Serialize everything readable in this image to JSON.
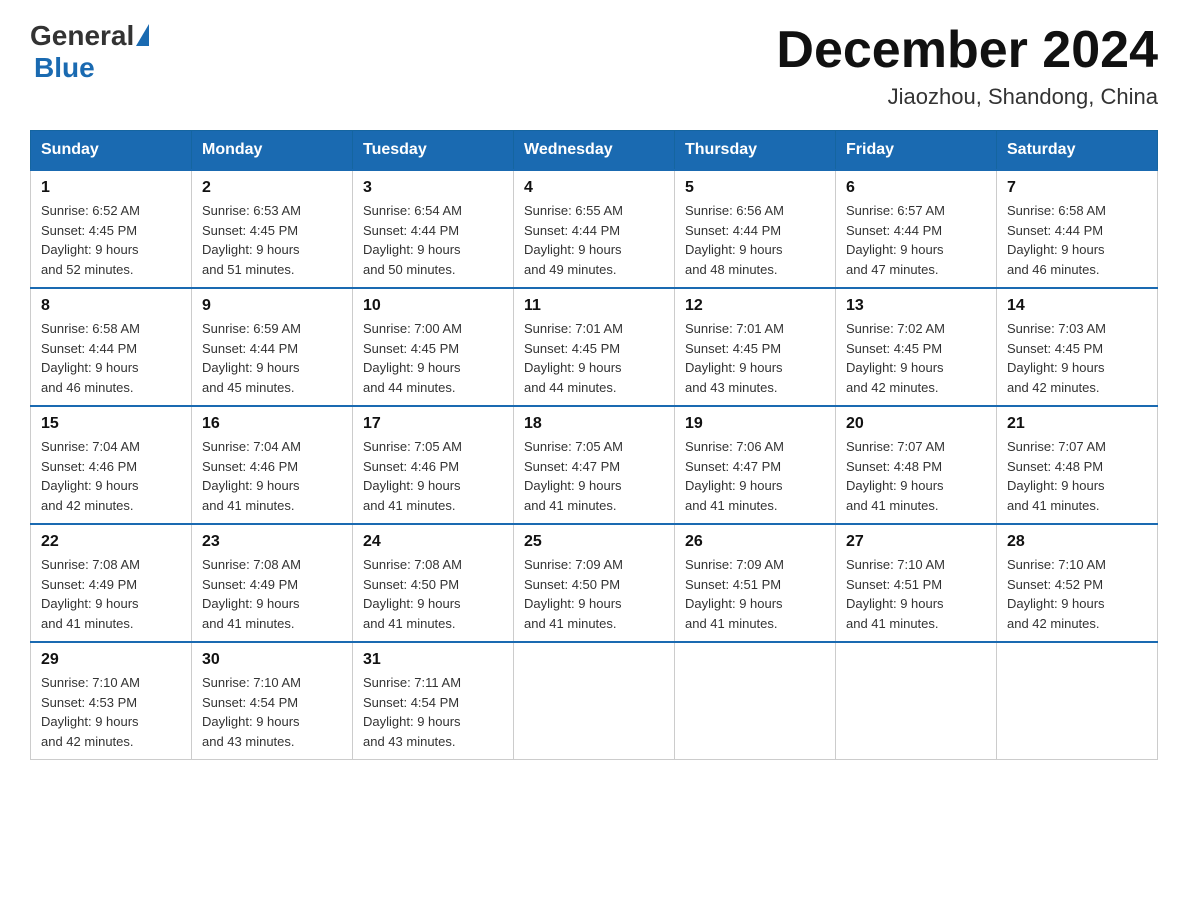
{
  "header": {
    "logo_general": "General",
    "logo_blue": "Blue",
    "title": "December 2024",
    "subtitle": "Jiaozhou, Shandong, China"
  },
  "columns": [
    "Sunday",
    "Monday",
    "Tuesday",
    "Wednesday",
    "Thursday",
    "Friday",
    "Saturday"
  ],
  "weeks": [
    [
      {
        "day": "1",
        "sunrise": "6:52 AM",
        "sunset": "4:45 PM",
        "daylight": "9 hours and 52 minutes."
      },
      {
        "day": "2",
        "sunrise": "6:53 AM",
        "sunset": "4:45 PM",
        "daylight": "9 hours and 51 minutes."
      },
      {
        "day": "3",
        "sunrise": "6:54 AM",
        "sunset": "4:44 PM",
        "daylight": "9 hours and 50 minutes."
      },
      {
        "day": "4",
        "sunrise": "6:55 AM",
        "sunset": "4:44 PM",
        "daylight": "9 hours and 49 minutes."
      },
      {
        "day": "5",
        "sunrise": "6:56 AM",
        "sunset": "4:44 PM",
        "daylight": "9 hours and 48 minutes."
      },
      {
        "day": "6",
        "sunrise": "6:57 AM",
        "sunset": "4:44 PM",
        "daylight": "9 hours and 47 minutes."
      },
      {
        "day": "7",
        "sunrise": "6:58 AM",
        "sunset": "4:44 PM",
        "daylight": "9 hours and 46 minutes."
      }
    ],
    [
      {
        "day": "8",
        "sunrise": "6:58 AM",
        "sunset": "4:44 PM",
        "daylight": "9 hours and 46 minutes."
      },
      {
        "day": "9",
        "sunrise": "6:59 AM",
        "sunset": "4:44 PM",
        "daylight": "9 hours and 45 minutes."
      },
      {
        "day": "10",
        "sunrise": "7:00 AM",
        "sunset": "4:45 PM",
        "daylight": "9 hours and 44 minutes."
      },
      {
        "day": "11",
        "sunrise": "7:01 AM",
        "sunset": "4:45 PM",
        "daylight": "9 hours and 44 minutes."
      },
      {
        "day": "12",
        "sunrise": "7:01 AM",
        "sunset": "4:45 PM",
        "daylight": "9 hours and 43 minutes."
      },
      {
        "day": "13",
        "sunrise": "7:02 AM",
        "sunset": "4:45 PM",
        "daylight": "9 hours and 42 minutes."
      },
      {
        "day": "14",
        "sunrise": "7:03 AM",
        "sunset": "4:45 PM",
        "daylight": "9 hours and 42 minutes."
      }
    ],
    [
      {
        "day": "15",
        "sunrise": "7:04 AM",
        "sunset": "4:46 PM",
        "daylight": "9 hours and 42 minutes."
      },
      {
        "day": "16",
        "sunrise": "7:04 AM",
        "sunset": "4:46 PM",
        "daylight": "9 hours and 41 minutes."
      },
      {
        "day": "17",
        "sunrise": "7:05 AM",
        "sunset": "4:46 PM",
        "daylight": "9 hours and 41 minutes."
      },
      {
        "day": "18",
        "sunrise": "7:05 AM",
        "sunset": "4:47 PM",
        "daylight": "9 hours and 41 minutes."
      },
      {
        "day": "19",
        "sunrise": "7:06 AM",
        "sunset": "4:47 PM",
        "daylight": "9 hours and 41 minutes."
      },
      {
        "day": "20",
        "sunrise": "7:07 AM",
        "sunset": "4:48 PM",
        "daylight": "9 hours and 41 minutes."
      },
      {
        "day": "21",
        "sunrise": "7:07 AM",
        "sunset": "4:48 PM",
        "daylight": "9 hours and 41 minutes."
      }
    ],
    [
      {
        "day": "22",
        "sunrise": "7:08 AM",
        "sunset": "4:49 PM",
        "daylight": "9 hours and 41 minutes."
      },
      {
        "day": "23",
        "sunrise": "7:08 AM",
        "sunset": "4:49 PM",
        "daylight": "9 hours and 41 minutes."
      },
      {
        "day": "24",
        "sunrise": "7:08 AM",
        "sunset": "4:50 PM",
        "daylight": "9 hours and 41 minutes."
      },
      {
        "day": "25",
        "sunrise": "7:09 AM",
        "sunset": "4:50 PM",
        "daylight": "9 hours and 41 minutes."
      },
      {
        "day": "26",
        "sunrise": "7:09 AM",
        "sunset": "4:51 PM",
        "daylight": "9 hours and 41 minutes."
      },
      {
        "day": "27",
        "sunrise": "7:10 AM",
        "sunset": "4:51 PM",
        "daylight": "9 hours and 41 minutes."
      },
      {
        "day": "28",
        "sunrise": "7:10 AM",
        "sunset": "4:52 PM",
        "daylight": "9 hours and 42 minutes."
      }
    ],
    [
      {
        "day": "29",
        "sunrise": "7:10 AM",
        "sunset": "4:53 PM",
        "daylight": "9 hours and 42 minutes."
      },
      {
        "day": "30",
        "sunrise": "7:10 AM",
        "sunset": "4:54 PM",
        "daylight": "9 hours and 43 minutes."
      },
      {
        "day": "31",
        "sunrise": "7:11 AM",
        "sunset": "4:54 PM",
        "daylight": "9 hours and 43 minutes."
      },
      null,
      null,
      null,
      null
    ]
  ],
  "labels": {
    "sunrise": "Sunrise: ",
    "sunset": "Sunset: ",
    "daylight": "Daylight: "
  }
}
